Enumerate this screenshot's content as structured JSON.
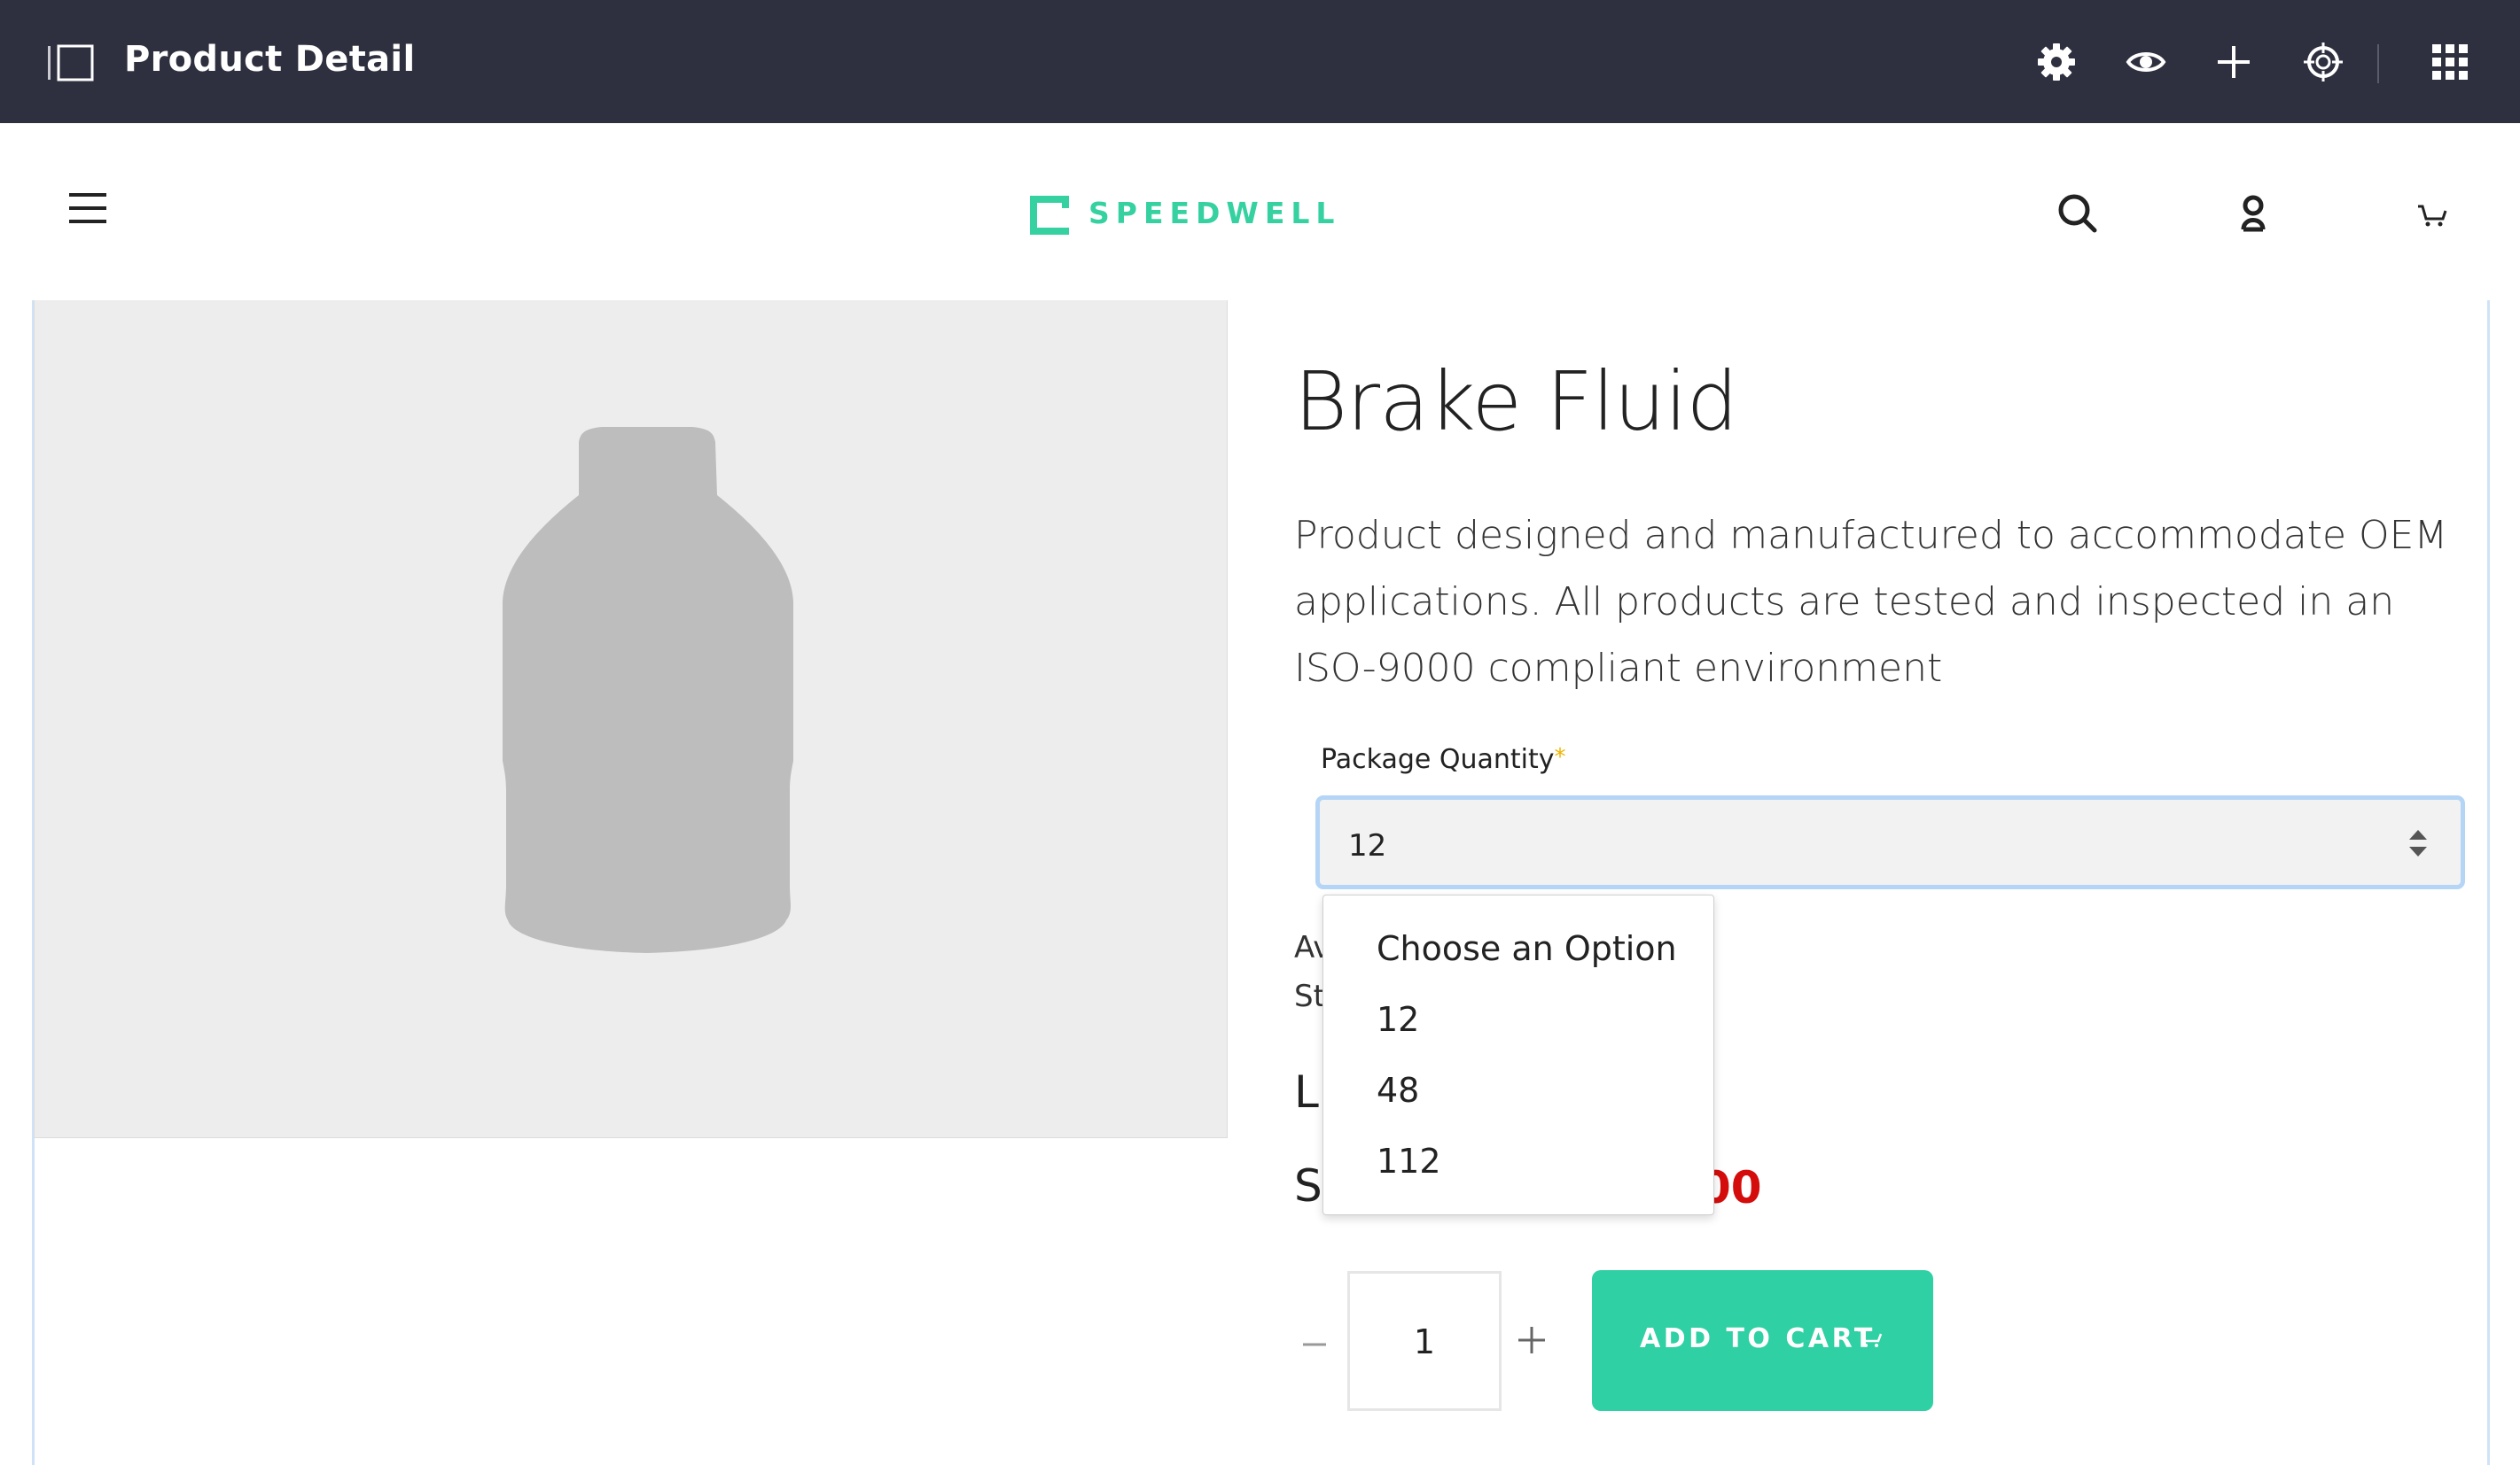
{
  "topbar": {
    "title": "Product Detail",
    "icons": [
      "panel-toggle-icon",
      "gear-icon",
      "eye-icon",
      "plus-icon",
      "target-icon",
      "apps-grid-icon"
    ]
  },
  "header": {
    "brand": "SPEEDWELL",
    "brand_color": "#36d1a0",
    "icons": [
      "hamburger-menu-icon",
      "search-icon",
      "user-icon",
      "cart-icon"
    ]
  },
  "product": {
    "title": "Brake Fluid",
    "description": "Product designed and manufactured to accommodate OEM applications. All products are tested and inspected in an ISO-9000 compliant environment",
    "image": "bottle-placeholder"
  },
  "package_quantity": {
    "label": "Package Quantity",
    "required_mark": "*",
    "selected": "12",
    "options": [
      "Choose an Option",
      "12",
      "48",
      "112"
    ]
  },
  "partially_hidden": {
    "availability_fragment": "Av",
    "stock_fragment": "St",
    "list_price_fragment": "LI",
    "sale_price_label_fragment": "SA",
    "sale_price_fragment": "00",
    "sale_price_color": "#d40c0c"
  },
  "cart": {
    "quantity": "1",
    "minus": "−",
    "plus": "+",
    "add_to_cart_label": "ADD TO CART",
    "button_color": "#2fd0a3"
  }
}
